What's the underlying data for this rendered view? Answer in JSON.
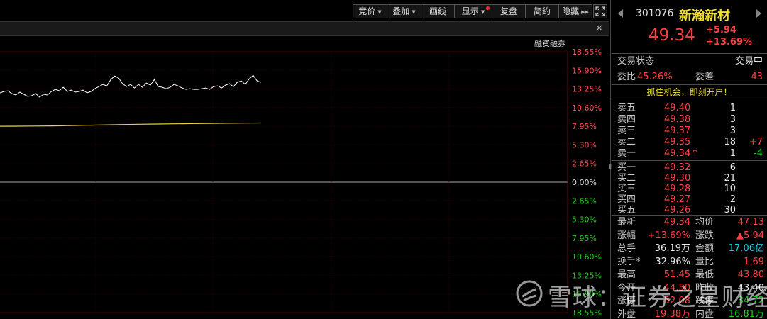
{
  "toolbar": {
    "buttons": [
      {
        "label": "竞价",
        "caret": "▼"
      },
      {
        "label": "叠加",
        "caret": "▼"
      },
      {
        "label": "画线"
      },
      {
        "label": "显示",
        "caret": "▼"
      },
      {
        "label": "复盘"
      },
      {
        "label": "简约"
      },
      {
        "label": "隐藏",
        "caret": "▶▶"
      }
    ],
    "fullscreen_icon": "expand-icon"
  },
  "panel": {
    "close_label": "✕",
    "overlay_label": "融资融券"
  },
  "axis": {
    "right_labels": [
      {
        "text": "18.55%",
        "tone": "red"
      },
      {
        "text": "15.90%",
        "tone": "red"
      },
      {
        "text": "13.25%",
        "tone": "red"
      },
      {
        "text": "10.60%",
        "tone": "red"
      },
      {
        "text": "7.95%",
        "tone": "red"
      },
      {
        "text": "5.30%",
        "tone": "red"
      },
      {
        "text": "2.65%",
        "tone": "red"
      },
      {
        "text": "0.00%",
        "tone": "white"
      },
      {
        "text": "2.65%",
        "tone": "green"
      },
      {
        "text": "5.30%",
        "tone": "green"
      },
      {
        "text": "7.95%",
        "tone": "green"
      },
      {
        "text": "10.60%",
        "tone": "green"
      },
      {
        "text": "13.25%",
        "tone": "green"
      },
      {
        "text": "15.90%",
        "tone": "green"
      },
      {
        "text": "18.55%",
        "tone": "green"
      }
    ]
  },
  "chart_data": {
    "type": "line",
    "y_unit": "%",
    "ylim": [
      -18.55,
      18.55
    ],
    "grid": true,
    "series": [
      {
        "color": "#ffffff",
        "values": [
          12.7,
          12.9,
          13.0,
          12.6,
          12.4,
          12.8,
          12.5,
          12.2,
          12.3,
          12.6,
          12.1,
          12.5,
          12.4,
          12.9,
          13.2,
          13.0,
          13.5,
          12.9,
          13.1,
          12.8,
          12.9,
          13.1,
          12.7,
          12.9,
          13.3,
          13.6,
          13.9,
          13.7,
          14.6,
          15.1,
          14.8,
          14.0,
          13.6,
          13.9,
          13.4,
          13.9,
          13.5,
          14.1,
          13.8,
          14.6,
          13.6,
          13.5,
          13.3,
          13.5,
          13.9,
          13.7,
          13.4,
          13.2,
          13.3,
          13.2,
          13.2,
          13.3,
          13.4,
          13.2,
          13.6,
          13.7,
          13.4,
          13.8,
          14.0,
          13.6,
          14.2,
          14.4,
          13.9,
          14.7,
          15.2,
          14.4,
          14.2
        ]
      },
      {
        "color": "#e6d23c",
        "values": [
          7.95,
          7.96,
          7.98,
          8.0,
          8.05,
          8.1,
          8.15,
          8.2,
          8.24,
          8.27,
          8.3,
          8.33,
          8.35,
          8.38,
          8.4,
          8.42
        ]
      }
    ]
  },
  "quote": {
    "code": "301076",
    "name": "新瀚新材",
    "price": "49.34",
    "change": "+5.94",
    "change_pct": "+13.69%",
    "status_label": "交易状态",
    "status_value": "交易中",
    "weibi_label": "委比",
    "weibi_value": "45.26%",
    "weicha_label": "委差",
    "weicha_value": "43",
    "promo": "抓住机会，即刻开户！",
    "sell": [
      {
        "label": "卖五",
        "price": "49.40",
        "vol": "1",
        "delta": ""
      },
      {
        "label": "卖四",
        "price": "49.38",
        "vol": "3",
        "delta": ""
      },
      {
        "label": "卖三",
        "price": "49.37",
        "vol": "3",
        "delta": ""
      },
      {
        "label": "卖二",
        "price": "49.35",
        "vol": "18",
        "delta": "+7"
      },
      {
        "label": "卖一",
        "price": "49.34",
        "vol": "1",
        "delta": "-4",
        "arrow": "↑"
      }
    ],
    "buy": [
      {
        "label": "买一",
        "price": "49.32",
        "vol": "6"
      },
      {
        "label": "买二",
        "price": "49.30",
        "vol": "21"
      },
      {
        "label": "买三",
        "price": "49.28",
        "vol": "10"
      },
      {
        "label": "买四",
        "price": "49.27",
        "vol": "2"
      },
      {
        "label": "买五",
        "price": "49.26",
        "vol": "30"
      }
    ],
    "stats": [
      {
        "l1": "最新",
        "v1": "49.34",
        "c1": "red",
        "l2": "均价",
        "v2": "47.13",
        "c2": "red"
      },
      {
        "l1": "涨幅",
        "v1": "+13.69%",
        "c1": "red",
        "l2": "涨跌",
        "v2": "▲5.94",
        "c2": "red"
      },
      {
        "l1": "总手",
        "v1": "36.19万",
        "c1": "white",
        "l2": "金额",
        "v2": "17.06亿",
        "c2": "cyan"
      },
      {
        "l1": "换手*",
        "v1": "32.96%",
        "c1": "white",
        "l2": "量比",
        "v2": "1.69",
        "c2": "red"
      },
      {
        "l1": "最高",
        "v1": "51.45",
        "c1": "red",
        "l2": "最低",
        "v2": "43.80",
        "c2": "red"
      },
      {
        "l1": "今开",
        "v1": "44.50",
        "c1": "red",
        "l2": "昨收",
        "v2": "43.40",
        "c2": "white"
      },
      {
        "l1": "涨停",
        "v1": "52.08",
        "c1": "red",
        "l2": "跌停",
        "v2": "34.72",
        "c2": "green"
      },
      {
        "l1": "外盘",
        "v1": "19.38万",
        "c1": "red",
        "l2": "内盘",
        "v2": "16.81万",
        "c2": "green"
      }
    ]
  },
  "watermark": {
    "text": "雪球：证券之星财经"
  }
}
